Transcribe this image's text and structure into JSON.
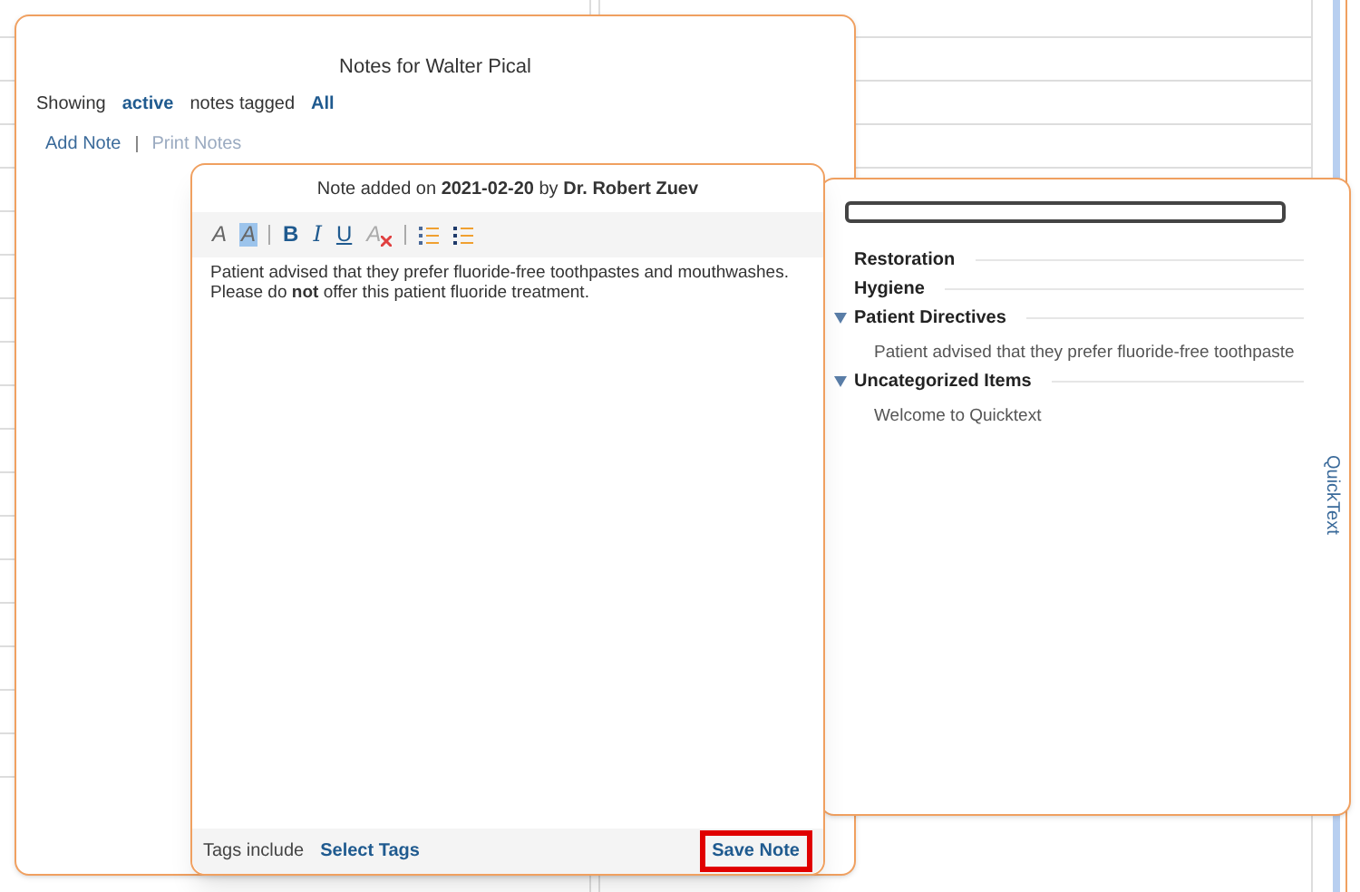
{
  "notes_window": {
    "title": "Notes for Walter Pical",
    "filter": {
      "prefix": "Showing",
      "status": "active",
      "middle": "notes tagged",
      "tag": "All"
    },
    "actions": [
      {
        "label": "Add Note",
        "disabled": false
      },
      {
        "label": "Print Notes",
        "disabled": true
      }
    ]
  },
  "note_editor": {
    "header": "Note added on **2021-02-20** by **Dr. Robert Zuev**",
    "toolbar": [
      {
        "kind": "font-color",
        "label": "A",
        "selected": false
      },
      {
        "kind": "highlight",
        "label": "A",
        "selected": true
      },
      {
        "kind": "separator"
      },
      {
        "kind": "bold",
        "label": "B",
        "selected": false
      },
      {
        "kind": "italic",
        "label": "I",
        "selected": false
      },
      {
        "kind": "underline",
        "label": "U",
        "selected": false
      },
      {
        "kind": "clear-format",
        "label": "A",
        "selected": false
      },
      {
        "kind": "separator"
      },
      {
        "kind": "ordered-list",
        "selected": false
      },
      {
        "kind": "bullet-list",
        "selected": false
      }
    ],
    "body": [
      "Patient advised that they prefer fluoride-free toothpastes and mouthwashes.",
      "Please do **not** offer this patient fluoride treatment."
    ],
    "footer": {
      "tags_label": "Tags include",
      "tags_link": "Select Tags",
      "save_button": {
        "label": "Save Note",
        "highlighted": true
      }
    }
  },
  "quicktext": {
    "tab_label": "QuickText",
    "categories": [
      {
        "label": "Restoration",
        "expanded": false
      },
      {
        "label": "Hygiene",
        "expanded": false
      },
      {
        "label": "Patient Directives",
        "expanded": true,
        "children": [
          "Patient advised that they prefer fluoride-free toothpaste"
        ]
      },
      {
        "label": "Uncategorized Items",
        "expanded": true,
        "children": [
          "Welcome to Quicktext"
        ]
      }
    ]
  }
}
